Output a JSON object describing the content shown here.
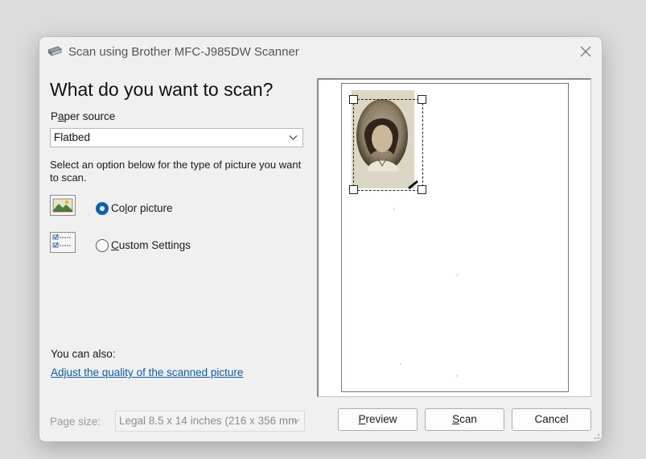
{
  "window": {
    "title": "Scan using Brother MFC-J985DW Scanner"
  },
  "main": {
    "heading": "What do you want to scan?",
    "paper_source": {
      "label_prefix": "P",
      "label_accel": "a",
      "label_rest": "per source",
      "selected": "Flatbed"
    },
    "description": "Select an option below for the type of picture you want to scan.",
    "options": [
      {
        "label_prefix": "Co",
        "label_accel": "l",
        "label_rest": "or picture",
        "selected": true,
        "icon": "color-picture-icon"
      },
      {
        "label_prefix": "",
        "label_accel": "C",
        "label_rest": "ustom Settings",
        "selected": false,
        "icon": "custom-settings-icon"
      }
    ],
    "also_label": "You can also:",
    "adjust_link": "Adjust the quality of the scanned picture",
    "page_size": {
      "label": "Page size:",
      "selected": "Legal 8.5 x 14 inches (216 x 356 mm"
    }
  },
  "buttons": {
    "preview_accel": "P",
    "preview_rest": "review",
    "scan_accel": "S",
    "scan_rest": "can",
    "cancel": "Cancel"
  },
  "colors": {
    "accent": "#0a5fb8",
    "link": "#0b5cad"
  }
}
